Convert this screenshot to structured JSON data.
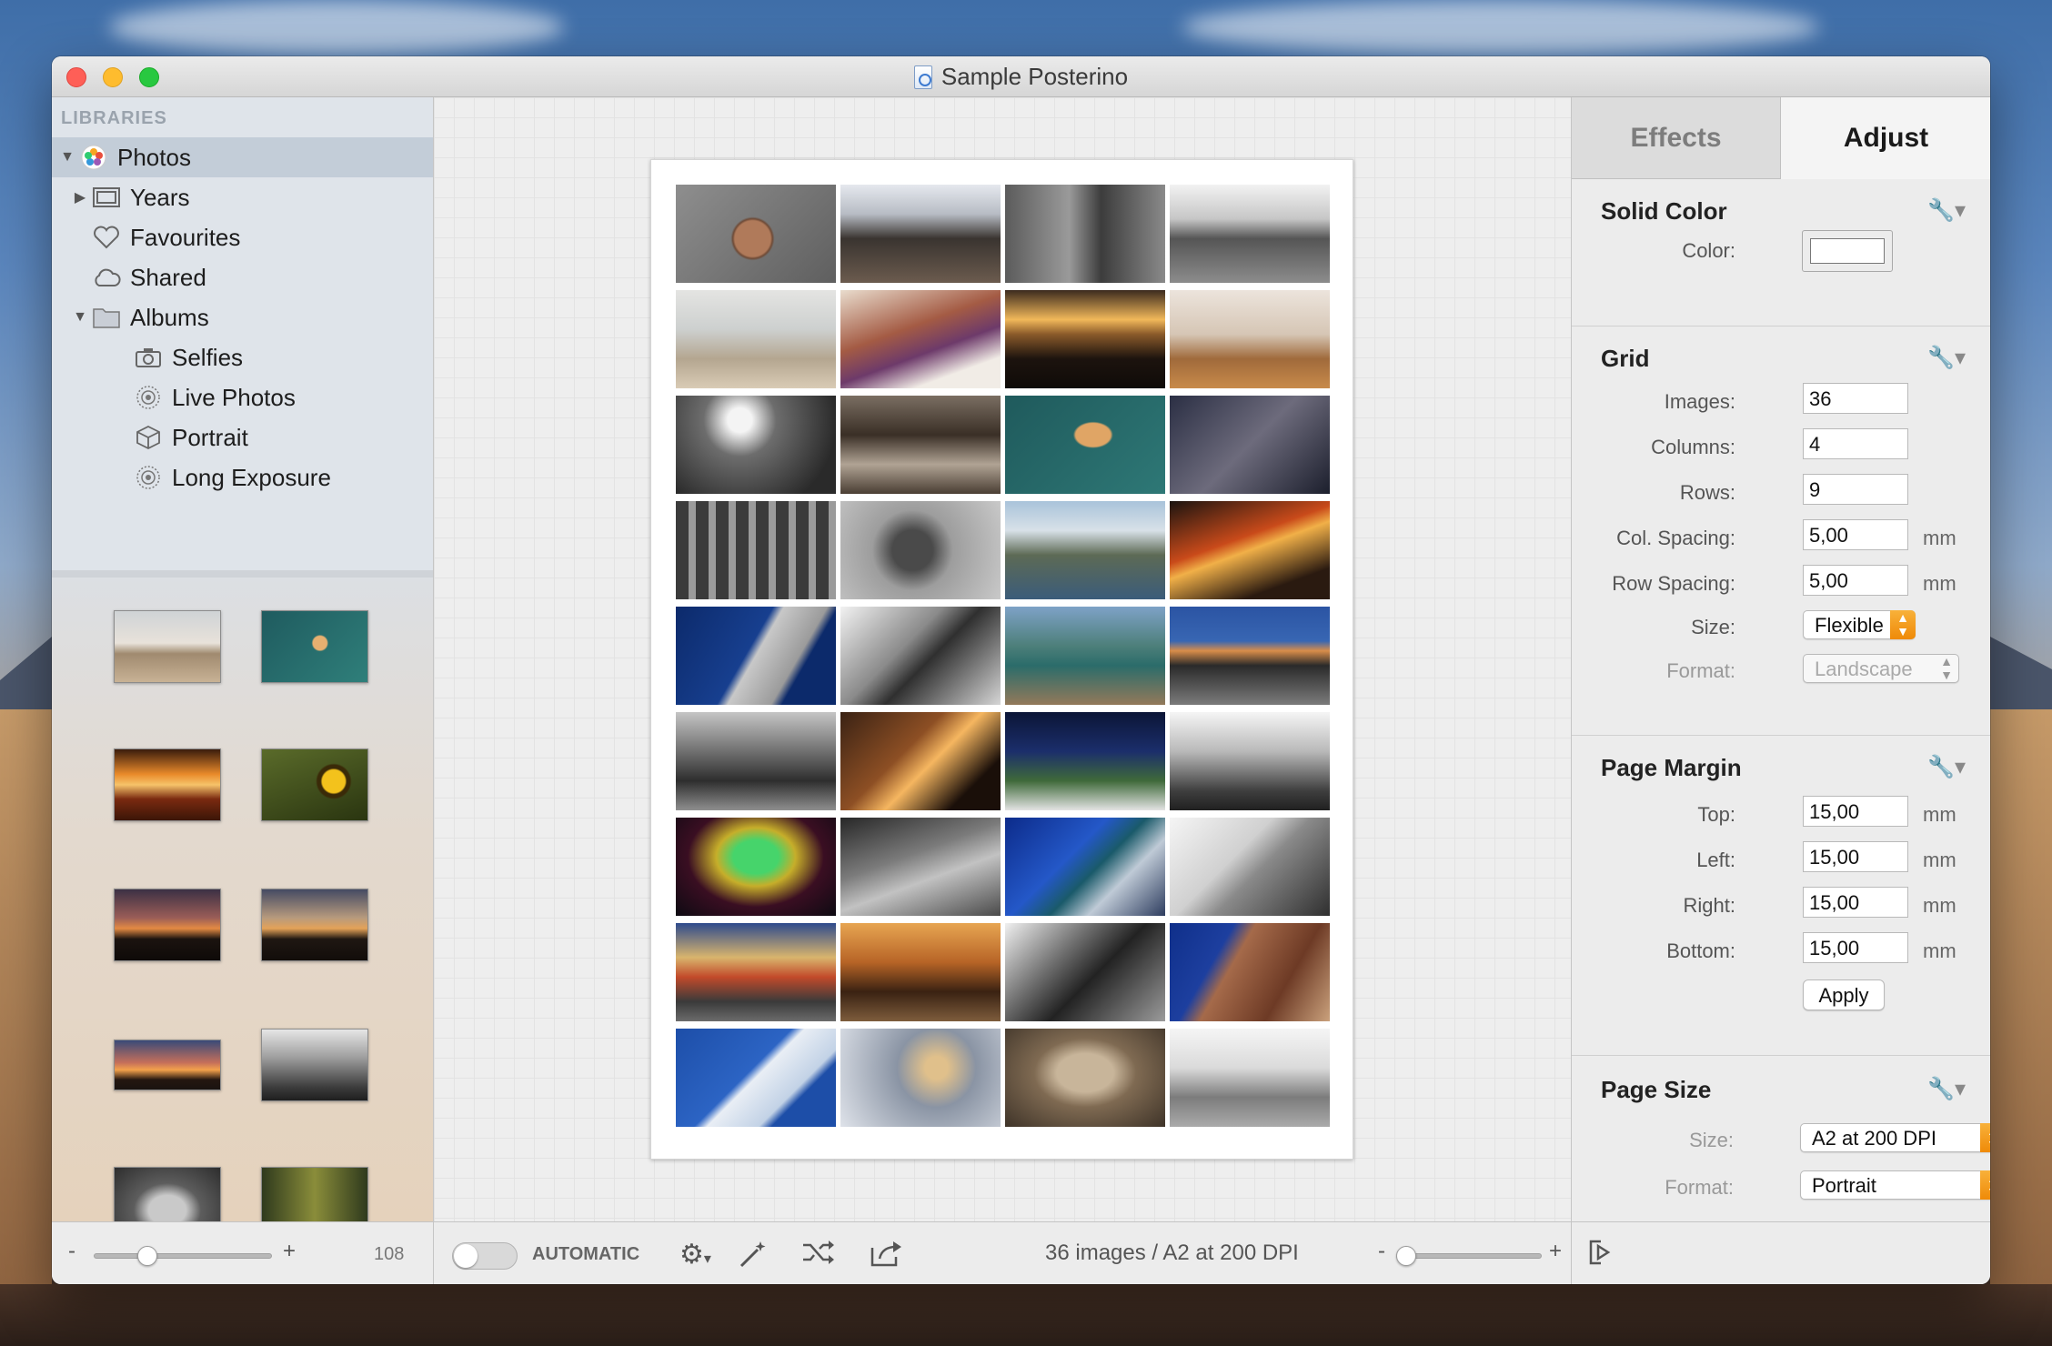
{
  "window": {
    "title": "Sample Posterino"
  },
  "sidebar": {
    "header": "LIBRARIES",
    "items": [
      {
        "label": "Photos",
        "icon": "photos-icon",
        "disclosure": "▼",
        "selected": true
      },
      {
        "label": "Years",
        "icon": "calendar-icon",
        "disclosure": "▶"
      },
      {
        "label": "Favourites",
        "icon": "heart-icon"
      },
      {
        "label": "Shared",
        "icon": "cloud-icon"
      },
      {
        "label": "Albums",
        "icon": "folder-icon",
        "disclosure": "▼"
      },
      {
        "label": "Selfies",
        "icon": "camera-icon"
      },
      {
        "label": "Live Photos",
        "icon": "live-photos-icon"
      },
      {
        "label": "Portrait",
        "icon": "cube-icon"
      },
      {
        "label": "Long Exposure",
        "icon": "long-exposure-icon"
      }
    ],
    "bottom": {
      "minus": "-",
      "plus": "+",
      "count": "108"
    }
  },
  "toolbar": {
    "automatic_label": "AUTOMATIC",
    "status": "36 images / A2 at 200 DPI",
    "zoom_minus": "-",
    "zoom_plus": "+"
  },
  "inspector": {
    "tabs": {
      "effects": "Effects",
      "adjust": "Adjust"
    },
    "solid_color": {
      "title": "Solid Color",
      "color_label": "Color:",
      "color_value": "#ffffff"
    },
    "grid": {
      "title": "Grid",
      "images_label": "Images:",
      "images": "36",
      "columns_label": "Columns:",
      "columns": "4",
      "rows_label": "Rows:",
      "rows": "9",
      "col_spacing_label": "Col. Spacing:",
      "col_spacing": "5,00",
      "row_spacing_label": "Row Spacing:",
      "row_spacing": "5,00",
      "unit": "mm",
      "size_label": "Size:",
      "size": "Flexible",
      "format_label": "Format:",
      "format": "Landscape"
    },
    "page_margin": {
      "title": "Page Margin",
      "top_label": "Top:",
      "top": "15,00",
      "left_label": "Left:",
      "left": "15,00",
      "right_label": "Right:",
      "right": "15,00",
      "bottom_label": "Bottom:",
      "bottom": "15,00",
      "unit": "mm",
      "apply": "Apply"
    },
    "page_size": {
      "title": "Page Size",
      "size_label": "Size:",
      "size": "A2 at 200 DPI",
      "format_label": "Format:",
      "format": "Portrait"
    }
  },
  "colors": {
    "accent_popup": "#ef8a08",
    "sidebar_selection": "#c3cdd8"
  },
  "poster": {
    "columns": 4,
    "rows": 9
  }
}
